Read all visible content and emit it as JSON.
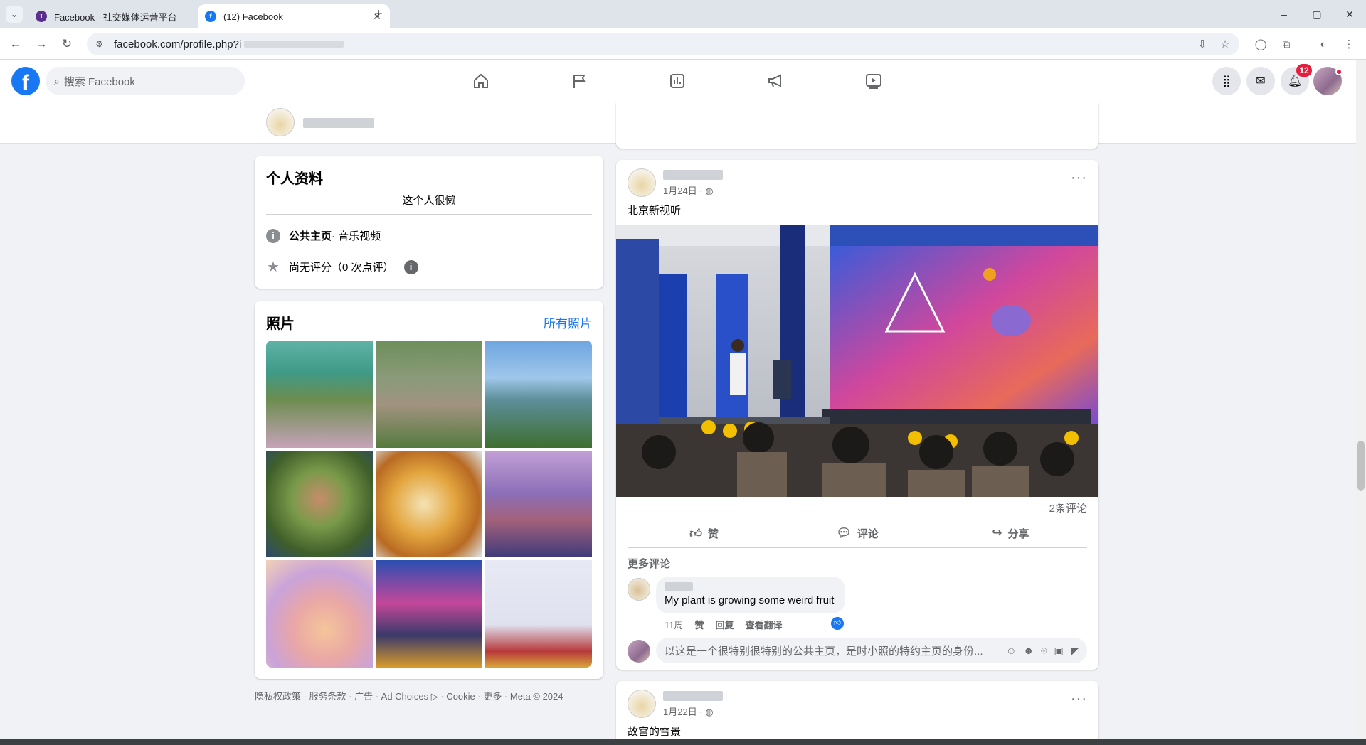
{
  "browser": {
    "tabs": [
      {
        "title": "Facebook - 社交媒体运营平台",
        "favicon_color": "#5b2d8e"
      },
      {
        "title": "(12) Facebook",
        "favicon_color": "#1877f2"
      }
    ],
    "new_tab": "+",
    "url": "facebook.com/profile.php?i",
    "window_controls": [
      "–",
      "▢",
      "✕"
    ]
  },
  "fb_nav": {
    "logo": "f",
    "search_placeholder": "搜索 Facebook",
    "notification_count": "12",
    "icons": [
      "home-icon",
      "flag-icon",
      "insights-icon",
      "megaphone-icon",
      "video-icon"
    ],
    "right_icons": [
      "menu-grid-icon",
      "messenger-icon",
      "bell-icon"
    ]
  },
  "page_header": {
    "more": "···"
  },
  "intro": {
    "title": "个人资料",
    "bio": "这个人很懒",
    "category_label": "公共主页",
    "category_value": " · 音乐视频",
    "rating": "尚无评分（0 次点评）"
  },
  "photos": {
    "title": "照片",
    "all_link": "所有照片",
    "tiles": [
      {
        "label": "lake-hillside",
        "gradient": "linear-gradient(180deg,#5fb3a7 0%,#3f9a86 30%,#6c8d4f 55%,#c6a3b8 100%)"
      },
      {
        "label": "village-ruins",
        "gradient": "linear-gradient(180deg,#6d8f5a 0%,#8a9a7a 35%,#a19380 60%,#557a3e 100%)"
      },
      {
        "label": "coast-view",
        "gradient": "linear-gradient(180deg,#6ea5e0 0%,#9fc7ea 35%,#5d8f9a 55%,#3e6e2f 100%)"
      },
      {
        "label": "tea-leaves",
        "gradient": "radial-gradient(circle at 50% 45%,#c88c6b 0%,#7a9a4a 35%,#3f5f2a 70%,#2e4a6e 100%)"
      },
      {
        "label": "tea-cups",
        "gradient": "radial-gradient(circle at 45% 50%,#f4e3b5 0%,#e3a53e 40%,#b86a22 70%,#dfe7ee 100%)"
      },
      {
        "label": "chimney-dusk",
        "gradient": "linear-gradient(180deg,#c29fd6 0%,#8b6fb8 40%,#a3617a 65%,#3e3b7a 100%)"
      },
      {
        "label": "cartoon-rabbit",
        "gradient": "radial-gradient(circle at 55% 65%,#f5c59a 0%,#e9a6a6 35%,#c9a3d9 65%,#f2d1b5 100%)"
      },
      {
        "label": "stage-event",
        "gradient": "linear-gradient(180deg,#2b4fb0 0%,#c4479a 40%,#3a3a6a 70%,#d99b2b 100%)"
      },
      {
        "label": "palace-snow",
        "gradient": "linear-gradient(180deg,#e7e9f4 0%,#dfe1ef 60%,#b7393a 85%,#d8a53a 100%)"
      }
    ]
  },
  "footer": {
    "text": "隐私权政策 · 服务条款 · 广告 · Ad Choices ▷ · Cookie · 更多 · Meta © 2024"
  },
  "post1": {
    "date": "1月24日 · ",
    "privacy_icon": "globe-icon",
    "text": "北京新视听",
    "comment_count": "2条评论",
    "actions": {
      "like": "赞",
      "comment": "评论",
      "share": "分享"
    },
    "more_comments": "更多评论",
    "comment": {
      "text": "My plant is growing some weird fruit",
      "time": "11周",
      "like": "赞",
      "reply": "回复",
      "translate": "查看翻译"
    },
    "reply_placeholder": "以这是一个很特别很特别的公共主页，是时小照的特约主页的身份..."
  },
  "post2": {
    "date": "1月22日 · ",
    "text": "故宫的雪景"
  }
}
